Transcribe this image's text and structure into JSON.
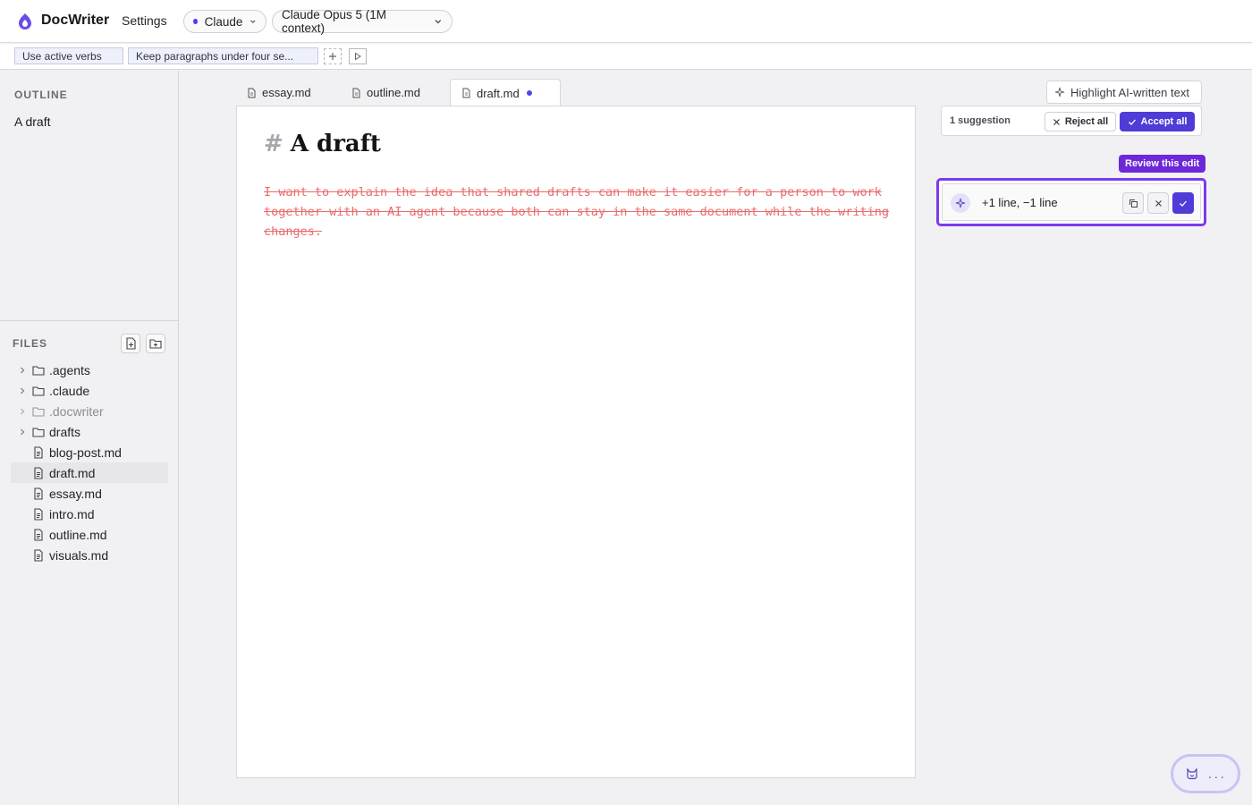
{
  "app": {
    "name": "DocWriter",
    "settings_label": "Settings",
    "provider": "Claude",
    "model": "Claude Opus 5 (1M context)"
  },
  "rules": {
    "items": [
      "Use active verbs",
      "Keep paragraphs under four se..."
    ]
  },
  "outline": {
    "heading": "OUTLINE",
    "items": [
      "A draft"
    ]
  },
  "files": {
    "heading": "FILES",
    "tree": [
      {
        "name": ".agents",
        "type": "folder"
      },
      {
        "name": ".claude",
        "type": "folder"
      },
      {
        "name": ".docwriter",
        "type": "folder",
        "muted": true
      },
      {
        "name": "drafts",
        "type": "folder"
      },
      {
        "name": "blog-post.md",
        "type": "file"
      },
      {
        "name": "draft.md",
        "type": "file",
        "active": true
      },
      {
        "name": "essay.md",
        "type": "file"
      },
      {
        "name": "intro.md",
        "type": "file"
      },
      {
        "name": "outline.md",
        "type": "file"
      },
      {
        "name": "visuals.md",
        "type": "file"
      }
    ]
  },
  "tabs": [
    {
      "label": "essay.md"
    },
    {
      "label": "outline.md"
    },
    {
      "label": "draft.md",
      "active": true,
      "modified": true
    }
  ],
  "document": {
    "heading_marker": "#",
    "title": "A draft",
    "deleted_text": "I want to explain the idea that shared drafts can make it easier for a person to work together with an AI agent because both can stay in the same document while the writing changes."
  },
  "review": {
    "highlight_label": "Highlight AI-written text",
    "suggestion_count": "1 suggestion",
    "reject_all": "Reject all",
    "accept_all": "Accept all",
    "review_tag": "Review this edit",
    "edit_summary": "+1 line, −1 line"
  },
  "chat": {
    "dots": "..."
  },
  "colors": {
    "accent": "#4f3bd6",
    "highlight_border": "#7c3aed",
    "deleted_text": "#ea6b6b"
  }
}
